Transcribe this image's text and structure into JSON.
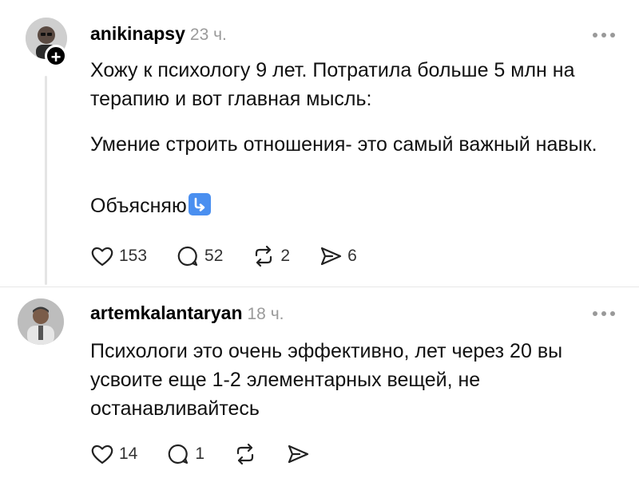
{
  "posts": [
    {
      "username": "anikinapsy",
      "time": "23 ч.",
      "lines": [
        "Хожу к психологу 9 лет. Потратила больше 5 млн на терапию и вот главная мысль:",
        "Умение строить отношения- это самый важный навык.",
        "Объясняю"
      ],
      "emoji": "arrow-down-right-emoji",
      "likes": "153",
      "comments": "52",
      "reposts": "2",
      "shares": "6",
      "follow_badge": "+"
    },
    {
      "username": "artemkalantaryan",
      "time": "18 ч.",
      "text": "Психологи это очень эффективно, лет через 20 вы усвоите еще 1-2 элементарных вещей, не останавливайтесь",
      "likes": "14",
      "comments": "1"
    }
  ],
  "colors": {
    "muted": "#9a9a9a",
    "emoji_bg": "#4a8ff0"
  }
}
